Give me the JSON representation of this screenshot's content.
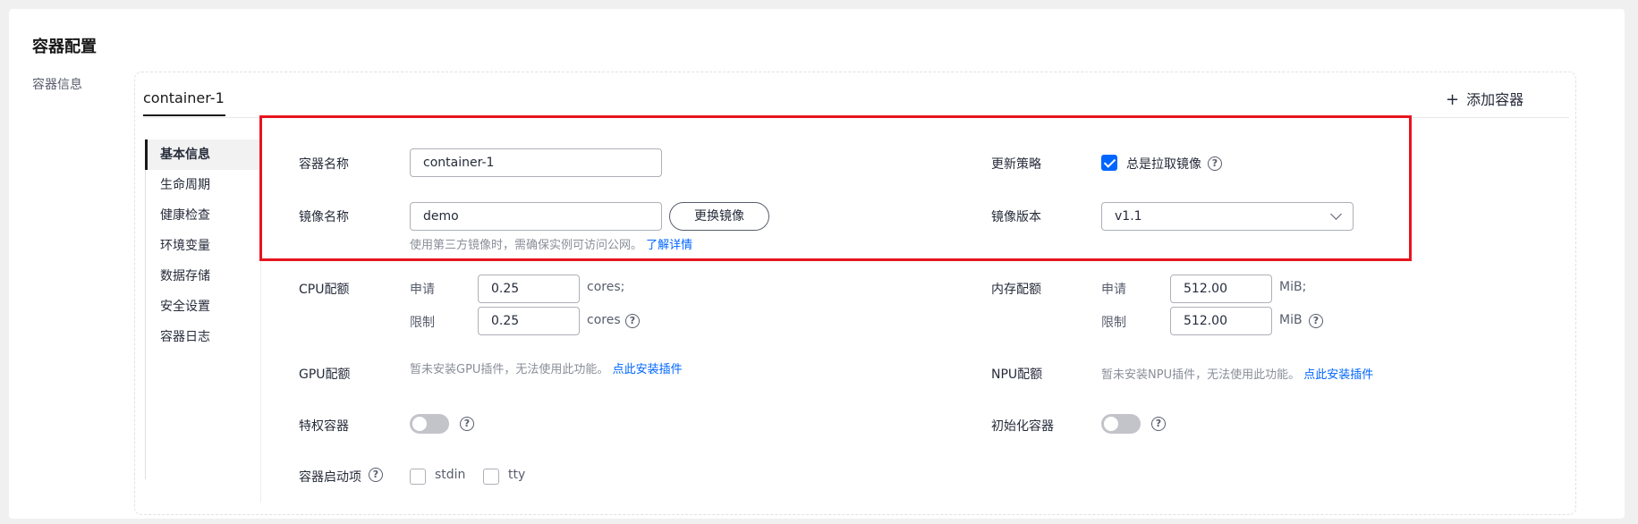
{
  "page": {
    "title": "容器配置",
    "section_label": "容器信息"
  },
  "tabs": {
    "active": "container-1",
    "add_label": "添加容器"
  },
  "nav": {
    "items": [
      "基本信息",
      "生命周期",
      "健康检查",
      "环境变量",
      "数据存储",
      "安全设置",
      "容器日志"
    ]
  },
  "form": {
    "container_name": {
      "label": "容器名称",
      "value": "container-1"
    },
    "update_policy": {
      "label": "更新策略",
      "checkbox_label": "总是拉取镜像",
      "checked": true
    },
    "image_name": {
      "label": "镜像名称",
      "value": "demo",
      "button": "更换镜像",
      "hint": "使用第三方镜像时，需确保实例可访问公网。",
      "hint_link": "了解详情"
    },
    "image_version": {
      "label": "镜像版本",
      "value": "v1.1"
    },
    "cpu": {
      "label": "CPU配额",
      "request_label": "申请",
      "request_value": "0.25",
      "request_unit": "cores;",
      "limit_label": "限制",
      "limit_value": "0.25",
      "limit_unit": "cores"
    },
    "memory": {
      "label": "内存配额",
      "request_label": "申请",
      "request_value": "512.00",
      "request_unit": "MiB;",
      "limit_label": "限制",
      "limit_value": "512.00",
      "limit_unit": "MiB"
    },
    "gpu": {
      "label": "GPU配额",
      "text": "暂未安装GPU插件，无法使用此功能。",
      "link": "点此安装插件"
    },
    "npu": {
      "label": "NPU配额",
      "text": "暂未安装NPU插件，无法使用此功能。",
      "link": "点此安装插件"
    },
    "privileged": {
      "label": "特权容器",
      "enabled": false
    },
    "init_container": {
      "label": "初始化容器",
      "enabled": false
    },
    "startup_options": {
      "label": "容器启动项",
      "options": [
        "stdin",
        "tty"
      ]
    }
  },
  "colors": {
    "accent": "#0066ff",
    "highlight_border": "#e8141f"
  }
}
